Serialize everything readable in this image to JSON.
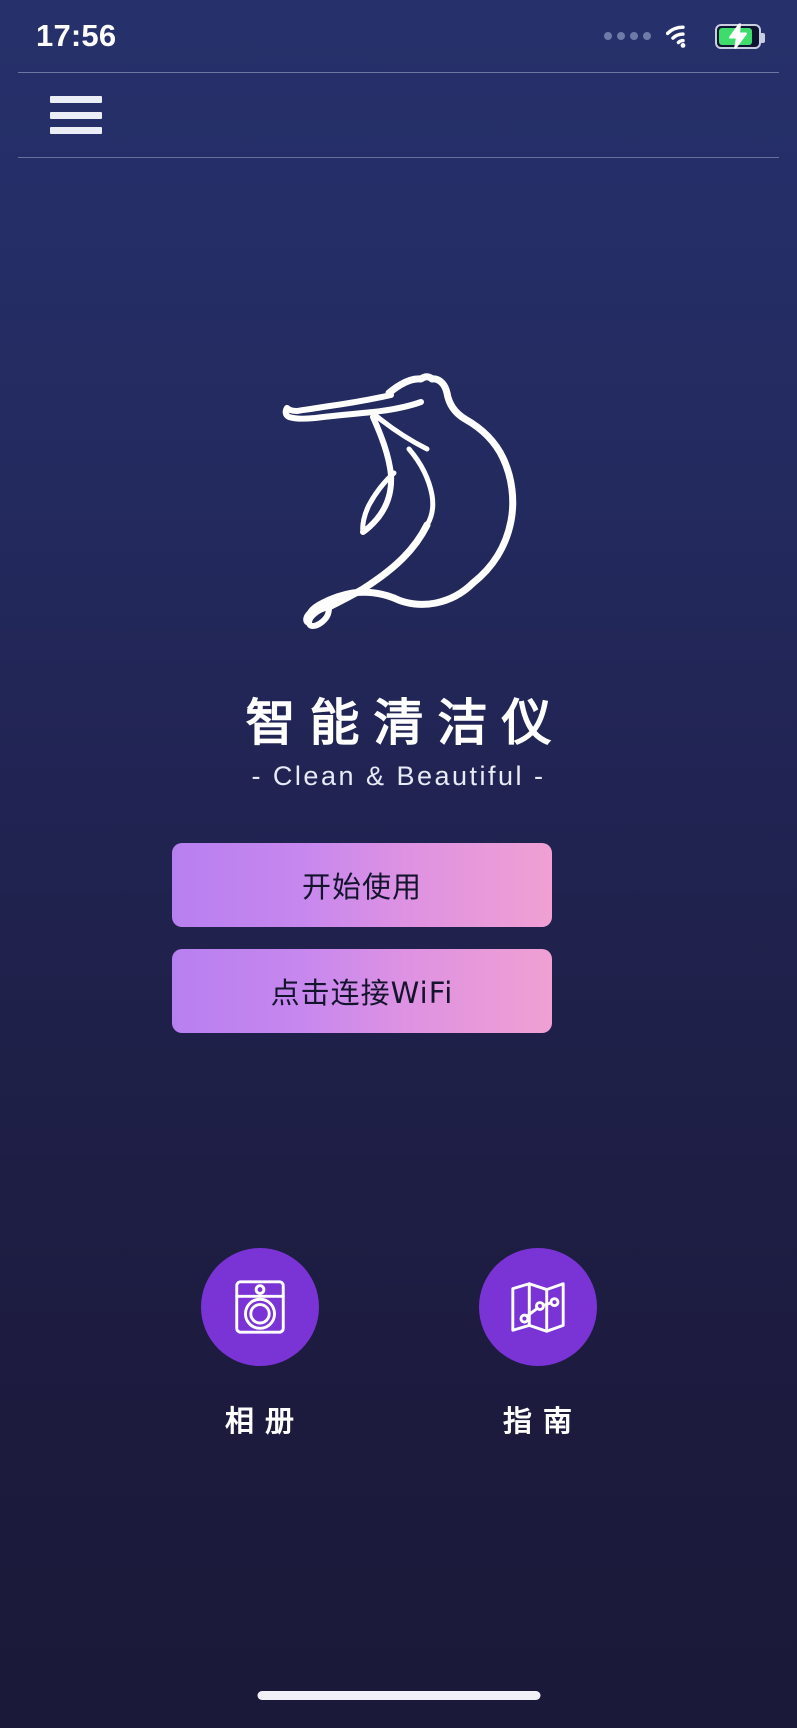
{
  "status_bar": {
    "time": "17:56",
    "signal_icon": "signal-dots-icon",
    "wifi_icon": "wifi-icon",
    "battery_icon": "battery-charging-icon",
    "battery_level_percent": 78,
    "battery_color": "#3ddc6b"
  },
  "navbar": {
    "menu_icon": "hamburger-menu-icon"
  },
  "branding": {
    "logo_icon": "dancer-figure-logo",
    "title": "智能清洁仪",
    "subtitle": "- Clean & Beautiful -"
  },
  "actions": {
    "start_label": "开始使用",
    "wifi_label": "点击连接WiFi",
    "gradient_from": "#b87ff0",
    "gradient_to": "#f0a0d3",
    "text_color": "#14142e"
  },
  "shortcuts": [
    {
      "icon": "washing-machine-icon",
      "label": "相册"
    },
    {
      "icon": "map-guide-icon",
      "label": "指南"
    }
  ],
  "theme": {
    "background_top": "#26306a",
    "background_bottom": "#1b1939",
    "circle_color": "#7a34d6",
    "accent": "#b87ff0"
  },
  "home_indicator": "home-indicator-bar"
}
